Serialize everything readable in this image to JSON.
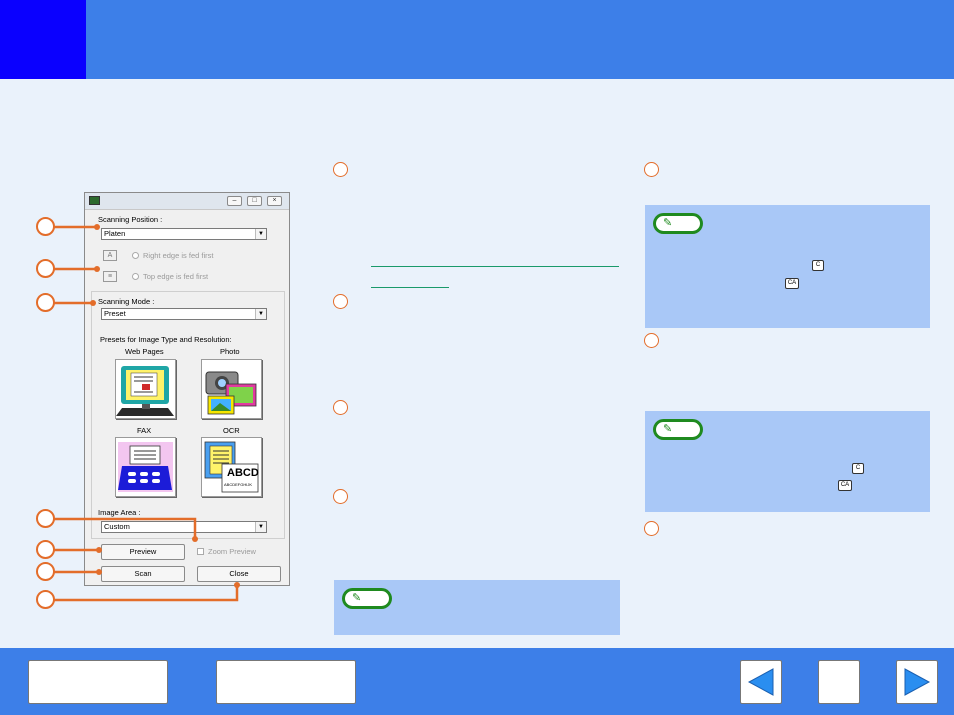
{
  "colors": {
    "header": "#3d7fe8",
    "chapter_tab": "#0a00ff",
    "background": "#eaf2fb",
    "callout_orange": "#e36d2a",
    "note_box": "#a9c8f7",
    "note_green": "#1f8a1f"
  },
  "dialog": {
    "scanning_position_label": "Scanning Position :",
    "scanning_position_value": "Platen",
    "right_edge_option": "Right edge is fed first",
    "top_edge_option": "Top edge is fed first",
    "scanning_mode_label": "Scanning Mode :",
    "scanning_mode_value": "Preset",
    "presets_label": "Presets for Image Type and Resolution:",
    "presets": [
      {
        "label": "Web Pages",
        "icon": "web-pages-icon"
      },
      {
        "label": "Photo",
        "icon": "photo-icon"
      },
      {
        "label": "FAX",
        "icon": "fax-icon"
      },
      {
        "label": "OCR",
        "icon": "ocr-icon"
      }
    ],
    "image_area_label": "Image Area :",
    "image_area_value": "Custom",
    "preview_button": "Preview",
    "zoom_preview_label": "Zoom Preview",
    "scan_button": "Scan",
    "close_button": "Close",
    "ocr_sample_text": "ABCD",
    "ocr_sample_small": "ABCDEFGHIJK"
  },
  "keys": {
    "clear": "C",
    "clear_all": "CA"
  }
}
